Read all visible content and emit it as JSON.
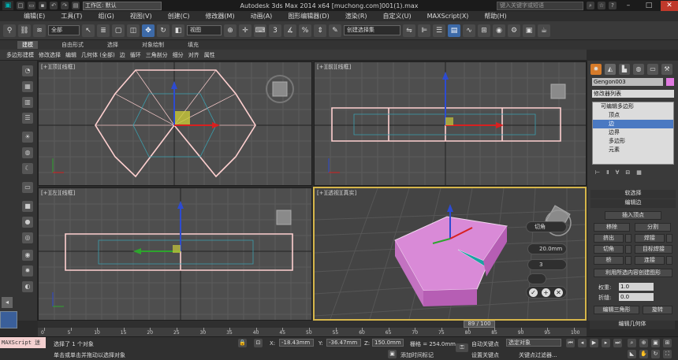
{
  "titlebar": {
    "workspace": "工作区: 默认",
    "title": "Autodesk 3ds Max  2014 x64      [muchong.com]001(1).max",
    "search_placeholder": "键入关键字或短语"
  },
  "menu": [
    "编辑(E)",
    "工具(T)",
    "组(G)",
    "视图(V)",
    "创建(C)",
    "修改器(M)",
    "动画(A)",
    "图形编辑器(D)",
    "渲染(R)",
    "自定义(U)",
    "MAXScript(X)",
    "帮助(H)"
  ],
  "toolbar": {
    "filter": "全部",
    "ref_coord": "视图",
    "named_sel": "创建选择集"
  },
  "ribbon": {
    "tabs": [
      "建模",
      "自由形式",
      "选择",
      "对象绘制",
      "填充"
    ],
    "sub": [
      "多边形建模",
      "修改选择",
      "编辑",
      "几何体 (全部)",
      "边",
      "循环",
      "三角剖分",
      "细分",
      "对齐",
      "属性"
    ]
  },
  "viewports": {
    "top_label": "[+][顶][线框]",
    "front_label": "[+][前][线框]",
    "left_label": "[+][左][线框]",
    "persp_label": "[+][透视][真实]"
  },
  "caddy": {
    "title": "切角",
    "amount": "20.0mm",
    "segments": "3"
  },
  "panel": {
    "object_name": "Gengon003",
    "modifier_list": "修改器列表",
    "stack": [
      "可编辑多边形",
      "顶点",
      "边",
      "边界",
      "多边形",
      "元素"
    ],
    "rollout_soft": "软选择",
    "rollout_edit_edges": "编辑边",
    "insert_vertex": "插入顶点",
    "remove": "移除",
    "split": "分割",
    "extrude": "挤出",
    "weld": "焊接",
    "chamfer": "切角",
    "target_weld": "目标焊接",
    "bridge": "桥",
    "connect": "连接",
    "create_shape": "利用所选内容创建图形",
    "weight_label": "权重:",
    "weight": "1.0",
    "crease_label": "折缝:",
    "crease": "0.0",
    "edit_tri": "编辑三角形",
    "turn": "旋转",
    "edit_geometry": "编辑几何体"
  },
  "timeline": {
    "frame": "89 / 100",
    "ticks": [
      "0",
      "5",
      "10",
      "15",
      "20",
      "25",
      "30",
      "35",
      "40",
      "45",
      "50",
      "55",
      "60",
      "65",
      "70",
      "75",
      "80",
      "85",
      "90",
      "95",
      "100"
    ]
  },
  "status": {
    "maxscript": "MAXScript 迷",
    "selected": "选择了 1 个对象",
    "prompt": "单击或单击并拖动以选择对象",
    "x": "-18.43mm",
    "y": "-36.47mm",
    "z": "150.0mm",
    "grid": "栅格 = 254.0mm",
    "autokey": "自动关键点",
    "setkey": "设置关键点",
    "sel_obj": "选定对象",
    "add_time_tag": "添加时间标记",
    "key_filters": "关键点过滤器..."
  },
  "colors": {
    "viewport_bg": "#4e4e4e",
    "selection": "#ffd0d0",
    "accent_active": "#d6b64a",
    "object_fill": "#d98ad7"
  }
}
